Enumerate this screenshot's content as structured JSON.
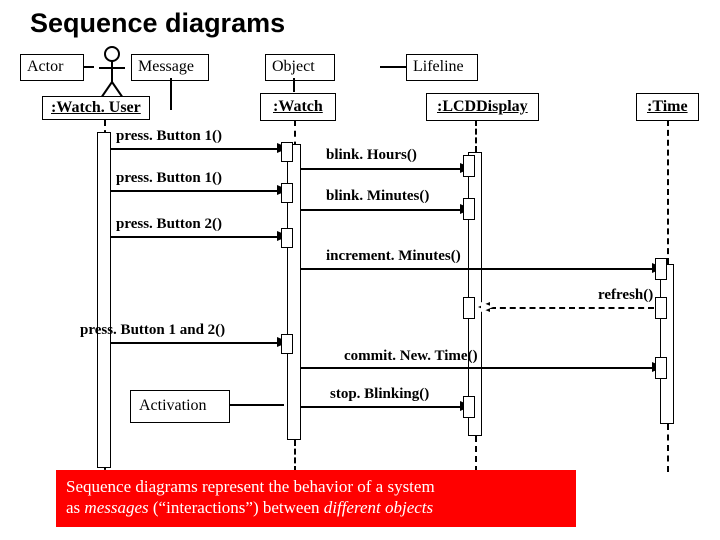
{
  "title": "Sequence diagrams",
  "callouts": {
    "actor": "Actor",
    "message": "Message",
    "object": "Object",
    "lifeline": "Lifeline",
    "activation": "Activation"
  },
  "participants": {
    "watch_user": ":Watch. User",
    "watch": ":Watch",
    "lcd": ":LCDDisplay",
    "time": ":Time"
  },
  "messages": {
    "press1a": "press. Button 1()",
    "press1b": "press. Button 1()",
    "press2": "press. Button 2()",
    "press12": "press. Button 1 and 2()",
    "blinkH": "blink. Hours()",
    "blinkM": "blink. Minutes()",
    "incM": "increment. Minutes()",
    "refresh": "refresh()",
    "commit": "commit. New. Time()",
    "stop": "stop. Blinking()"
  },
  "caption_line1": "Sequence diagrams represent the behavior of a system",
  "caption_italic1": "messages",
  "caption_mid": " (“interactions”) between ",
  "caption_italic2": "different objects",
  "chart_data": {
    "type": "sequence-diagram",
    "participants": [
      {
        "id": "watch_user",
        "label": ":Watch. User",
        "kind": "actor"
      },
      {
        "id": "watch",
        "label": ":Watch",
        "kind": "object"
      },
      {
        "id": "lcd",
        "label": ":LCDDisplay",
        "kind": "object"
      },
      {
        "id": "time",
        "label": ":Time",
        "kind": "object"
      }
    ],
    "messages": [
      {
        "from": "watch_user",
        "to": "watch",
        "label": "press. Button 1()"
      },
      {
        "from": "watch",
        "to": "lcd",
        "label": "blink. Hours()"
      },
      {
        "from": "watch_user",
        "to": "watch",
        "label": "press. Button 1()"
      },
      {
        "from": "watch",
        "to": "lcd",
        "label": "blink. Minutes()"
      },
      {
        "from": "watch_user",
        "to": "watch",
        "label": "press. Button 2()"
      },
      {
        "from": "watch",
        "to": "time",
        "label": "increment. Minutes()"
      },
      {
        "from": "time",
        "to": "lcd",
        "label": "refresh()",
        "return": true
      },
      {
        "from": "watch_user",
        "to": "watch",
        "label": "press. Button 1 and 2()"
      },
      {
        "from": "watch",
        "to": "time",
        "label": "commit. New. Time()"
      },
      {
        "from": "watch",
        "to": "lcd",
        "label": "stop. Blinking()"
      }
    ],
    "annotations": [
      "Actor",
      "Message",
      "Object",
      "Lifeline",
      "Activation"
    ]
  }
}
